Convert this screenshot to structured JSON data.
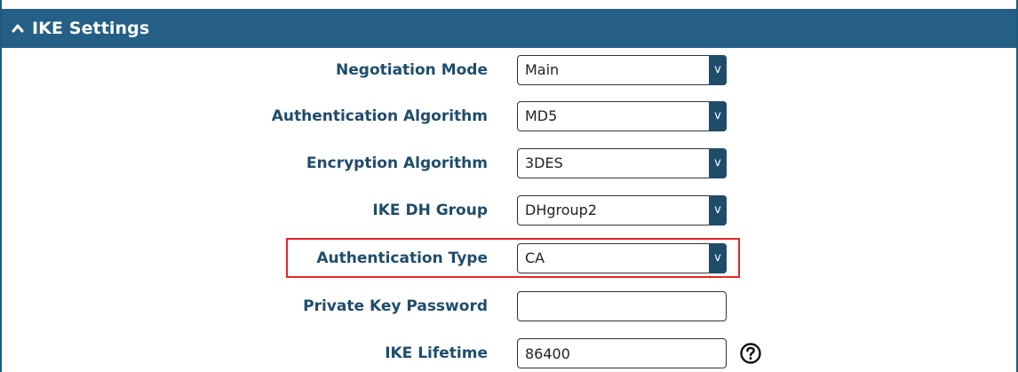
{
  "section": {
    "title": "IKE Settings",
    "collapse_icon": "chevron-up-icon"
  },
  "fields": {
    "negotiation_mode": {
      "label": "Negotiation Mode",
      "value": "Main"
    },
    "authentication_algorithm": {
      "label": "Authentication Algorithm",
      "value": "MD5"
    },
    "encryption_algorithm": {
      "label": "Encryption Algorithm",
      "value": "3DES"
    },
    "ike_dh_group": {
      "label": "IKE DH Group",
      "value": "DHgroup2"
    },
    "authentication_type": {
      "label": "Authentication Type",
      "value": "CA"
    },
    "private_key_password": {
      "label": "Private Key Password",
      "value": ""
    },
    "ike_lifetime": {
      "label": "IKE Lifetime",
      "value": "86400",
      "help_icon": "help-circle-icon"
    }
  },
  "select_arrow_glyph": "v",
  "colors": {
    "header_bg": "#255f85",
    "label_text": "#1f4c6b",
    "highlight": "#e52626"
  }
}
